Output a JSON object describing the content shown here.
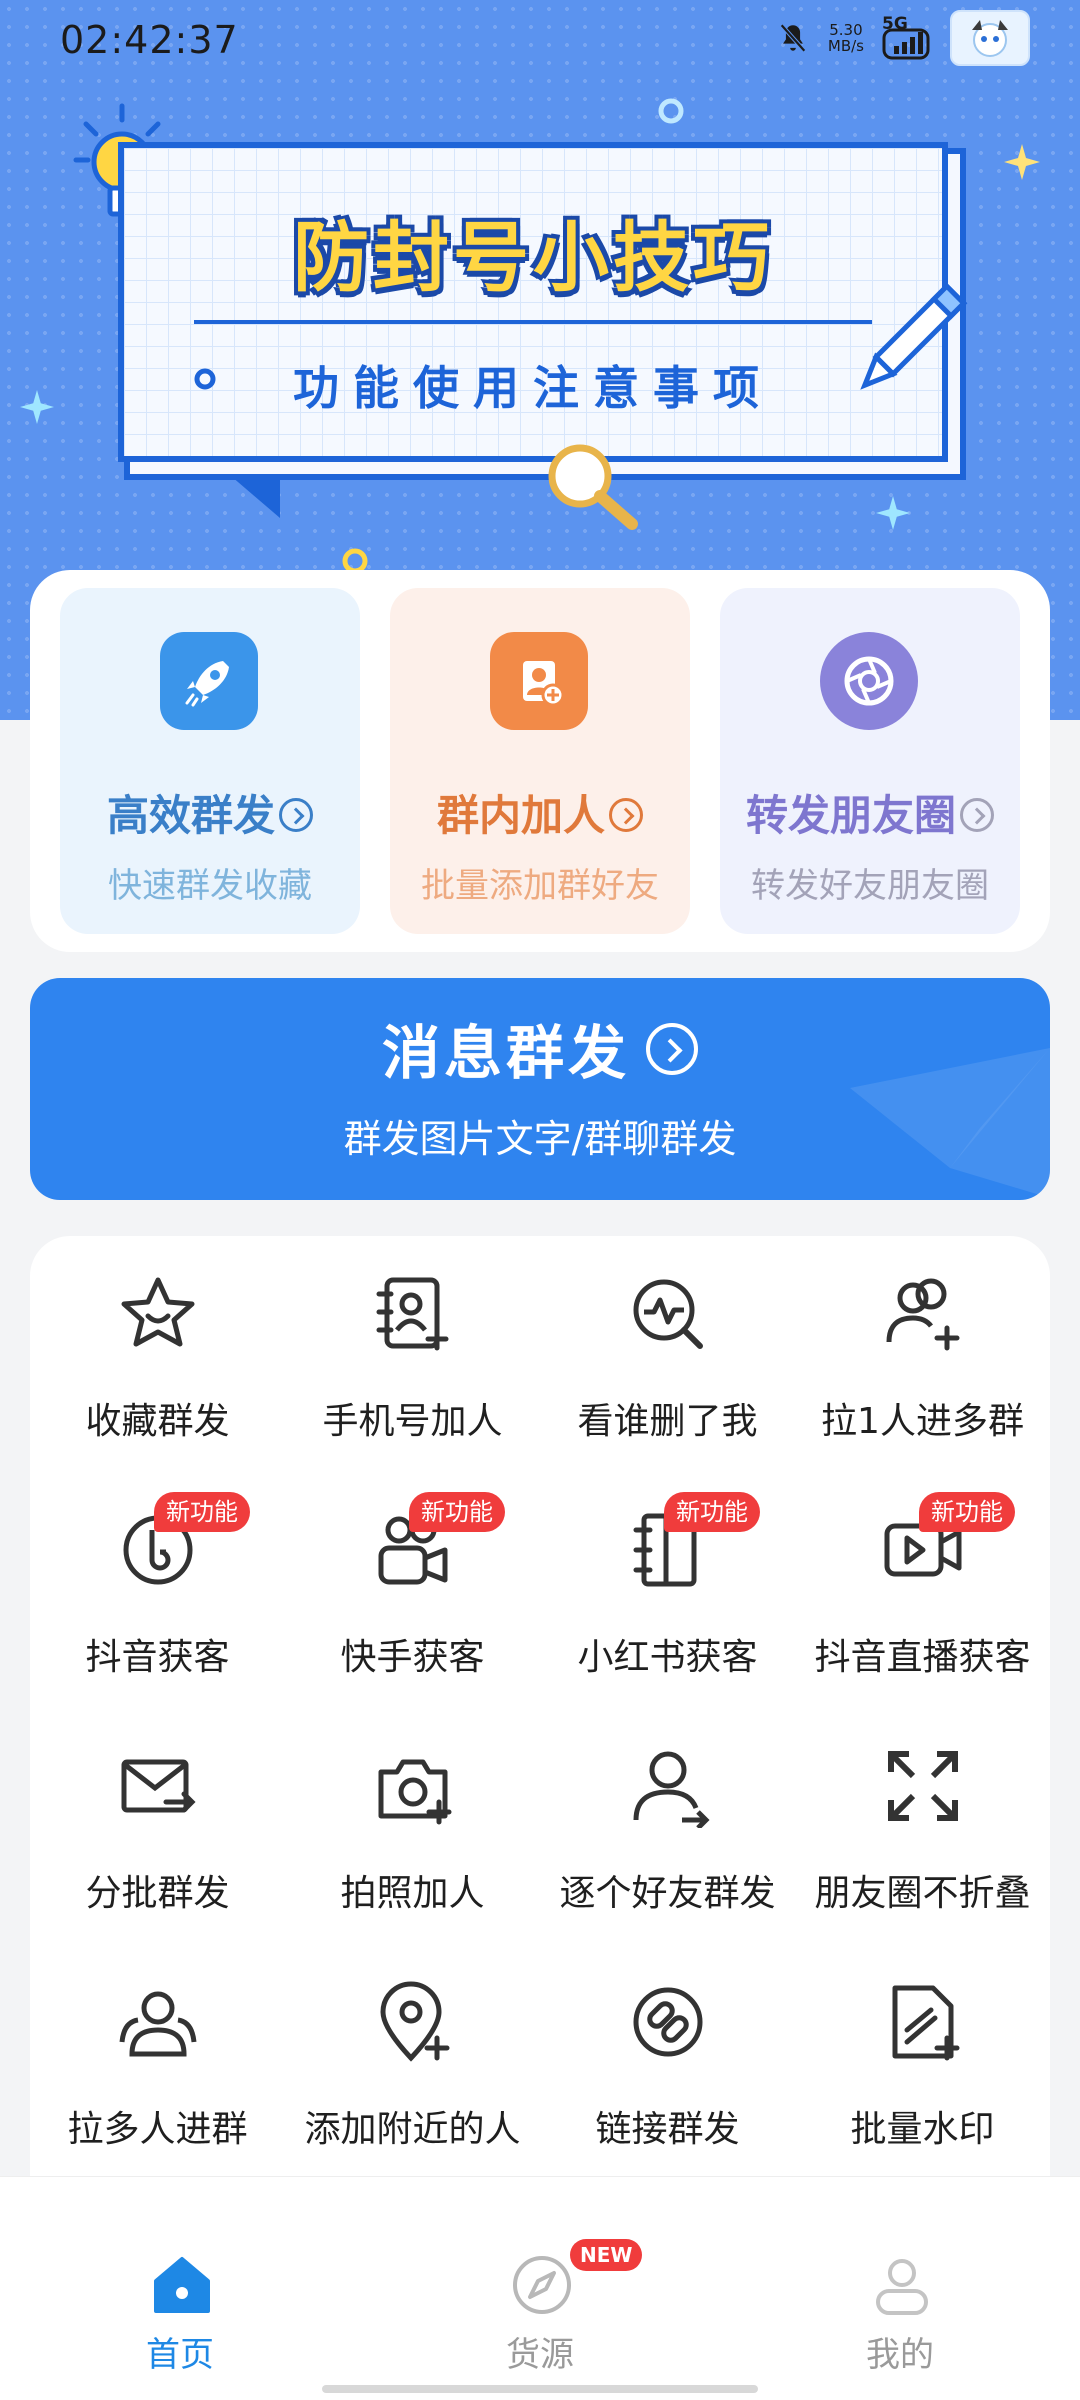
{
  "status_bar": {
    "time": "02:42:37",
    "net_speed": "5.30",
    "net_unit": "MB/s",
    "network": "5G"
  },
  "banner": {
    "title": "防封号小技巧",
    "subtitle": "功能使用注意事项"
  },
  "feature_cards": [
    {
      "title": "高效群发",
      "subtitle": "快速群发收藏",
      "icon": "rocket-icon",
      "color": "#3a7fc8",
      "bg": "#eaf4fd",
      "icon_bg": "#3b95ea",
      "sub_color": "#7fb4dc"
    },
    {
      "title": "群内加人",
      "subtitle": "批量添加群好友",
      "icon": "add-contact-icon",
      "color": "#e0793b",
      "bg": "#fdf0ea",
      "icon_bg": "#f28a48",
      "sub_color": "#eeaa80"
    },
    {
      "title": "转发朋友圈",
      "subtitle": "转发好友朋友圈",
      "icon": "aperture-icon",
      "color": "#7e76cf",
      "bg": "#eff2fd",
      "icon_bg": "#8a83da",
      "sub_color": "#a3a3b8"
    }
  ],
  "broadcast": {
    "title": "消息群发",
    "subtitle": "群发图片文字/群聊群发"
  },
  "grid": [
    {
      "label": "收藏群发",
      "icon": "star-icon",
      "badge": ""
    },
    {
      "label": "手机号加人",
      "icon": "phone-contact-icon",
      "badge": ""
    },
    {
      "label": "看谁删了我",
      "icon": "search-pulse-icon",
      "badge": ""
    },
    {
      "label": "拉1人进多群",
      "icon": "group-add-icon",
      "badge": ""
    },
    {
      "label": "抖音获客",
      "icon": "douyin-icon",
      "badge": "新功能"
    },
    {
      "label": "快手获客",
      "icon": "kuaishou-icon",
      "badge": "新功能"
    },
    {
      "label": "小红书获客",
      "icon": "notebook-icon",
      "badge": "新功能"
    },
    {
      "label": "抖音直播获客",
      "icon": "video-icon",
      "badge": "新功能"
    },
    {
      "label": "分批群发",
      "icon": "mail-send-icon",
      "badge": ""
    },
    {
      "label": "拍照加人",
      "icon": "camera-add-icon",
      "badge": ""
    },
    {
      "label": "逐个好友群发",
      "icon": "user-send-icon",
      "badge": ""
    },
    {
      "label": "朋友圈不折叠",
      "icon": "expand-icon",
      "badge": ""
    },
    {
      "label": "拉多人进群",
      "icon": "users-icon",
      "badge": ""
    },
    {
      "label": "添加附近的人",
      "icon": "location-add-icon",
      "badge": ""
    },
    {
      "label": "链接群发",
      "icon": "link-icon",
      "badge": ""
    },
    {
      "label": "批量水印",
      "icon": "doc-edit-icon",
      "badge": ""
    }
  ],
  "bottom_nav": [
    {
      "label": "首页",
      "icon": "home-icon",
      "active": true,
      "color": "#1e88e5"
    },
    {
      "label": "货源",
      "icon": "compass-icon",
      "active": false,
      "badge": "NEW",
      "color": "#9a9a9a"
    },
    {
      "label": "我的",
      "icon": "profile-icon",
      "active": false,
      "color": "#9a9a9a"
    }
  ]
}
